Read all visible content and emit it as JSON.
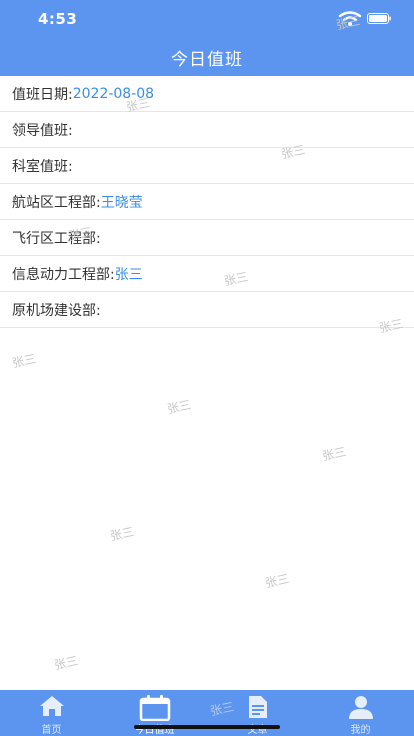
{
  "status": {
    "time": "4:53"
  },
  "header": {
    "title": "今日值班"
  },
  "rows": [
    {
      "label": "值班日期:",
      "value": "2022-08-08"
    },
    {
      "label": "领导值班:",
      "value": ""
    },
    {
      "label": "科室值班:",
      "value": ""
    },
    {
      "label": "航站区工程部:",
      "value": "王晓莹"
    },
    {
      "label": "飞行区工程部:",
      "value": ""
    },
    {
      "label": "信息动力工程部:",
      "value": "张三"
    },
    {
      "label": "原机场建设部:",
      "value": ""
    }
  ],
  "watermark": "张三",
  "tabs": [
    {
      "label": "首页",
      "icon": "home-icon"
    },
    {
      "label": "今日值班",
      "icon": "calendar-icon"
    },
    {
      "label": "文章",
      "icon": "document-icon"
    },
    {
      "label": "我的",
      "icon": "person-icon"
    }
  ],
  "colors": {
    "primary": "#5b95f0",
    "value": "#3a8ee6"
  }
}
